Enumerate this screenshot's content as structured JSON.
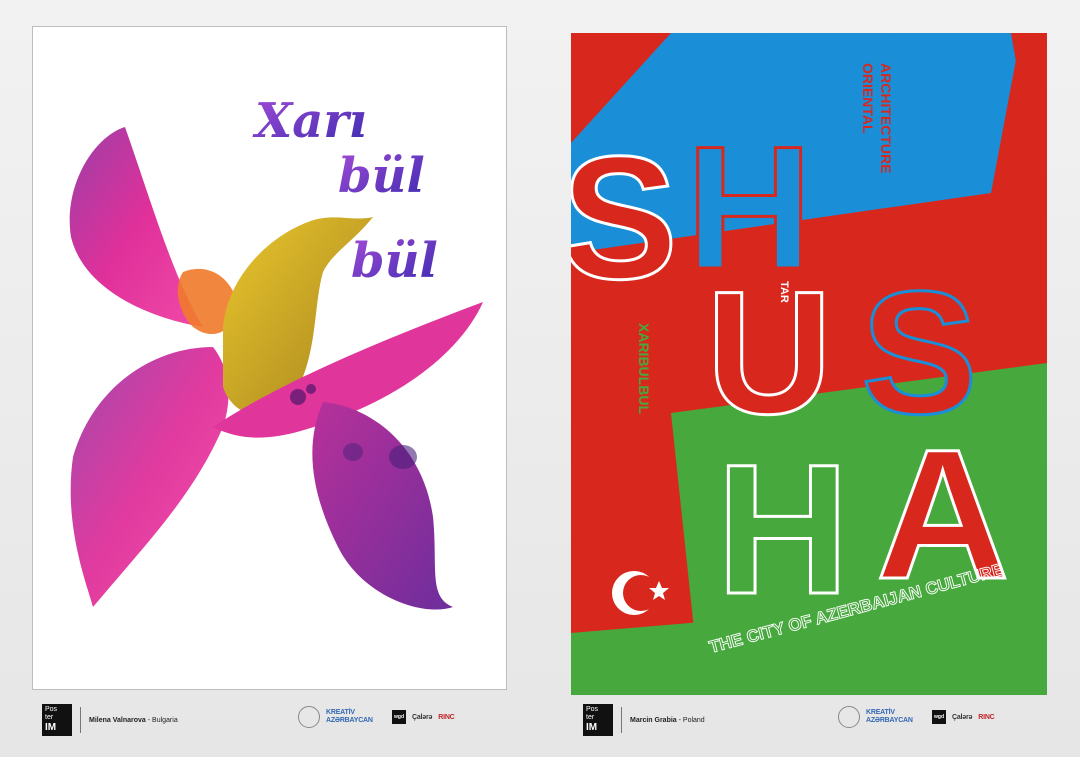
{
  "left_poster": {
    "lettering": [
      "Xarı",
      "bül",
      "bül"
    ],
    "footer": {
      "logo_lines": [
        "Pos",
        "ter",
        "IM"
      ],
      "author": "Milena Valnarova",
      "country": " - Bulgaria"
    },
    "sponsors": [
      "KREATİV AZƏRBAYCAN",
      "wgd",
      "Çalərə",
      "RINC"
    ]
  },
  "right_poster": {
    "letters_row1": [
      "S",
      "H"
    ],
    "letters_row2": [
      "U",
      "S"
    ],
    "letters_row3": [
      "H",
      "A"
    ],
    "side_top": [
      "ORIENTAL",
      "ARCHITECTURE"
    ],
    "word_tar": "TAR",
    "word_xaribulbul": "XARIBULBUL",
    "tagline": "THE CITY OF AZERBAIJAN CULTURE",
    "footer": {
      "logo_lines": [
        "Pos",
        "ter",
        "IM"
      ],
      "author": "Marcin Grabia",
      "country": " - Poland"
    },
    "sponsors": [
      "KREATİV AZƏRBAYCAN",
      "wgd",
      "Çalərə",
      "RINC"
    ]
  },
  "colors": {
    "blue": "#1a8fd8",
    "red": "#d8281d",
    "green": "#47a83d",
    "magenta": "#d2308f",
    "purple": "#7a2fa0",
    "gold": "#c9a227"
  }
}
